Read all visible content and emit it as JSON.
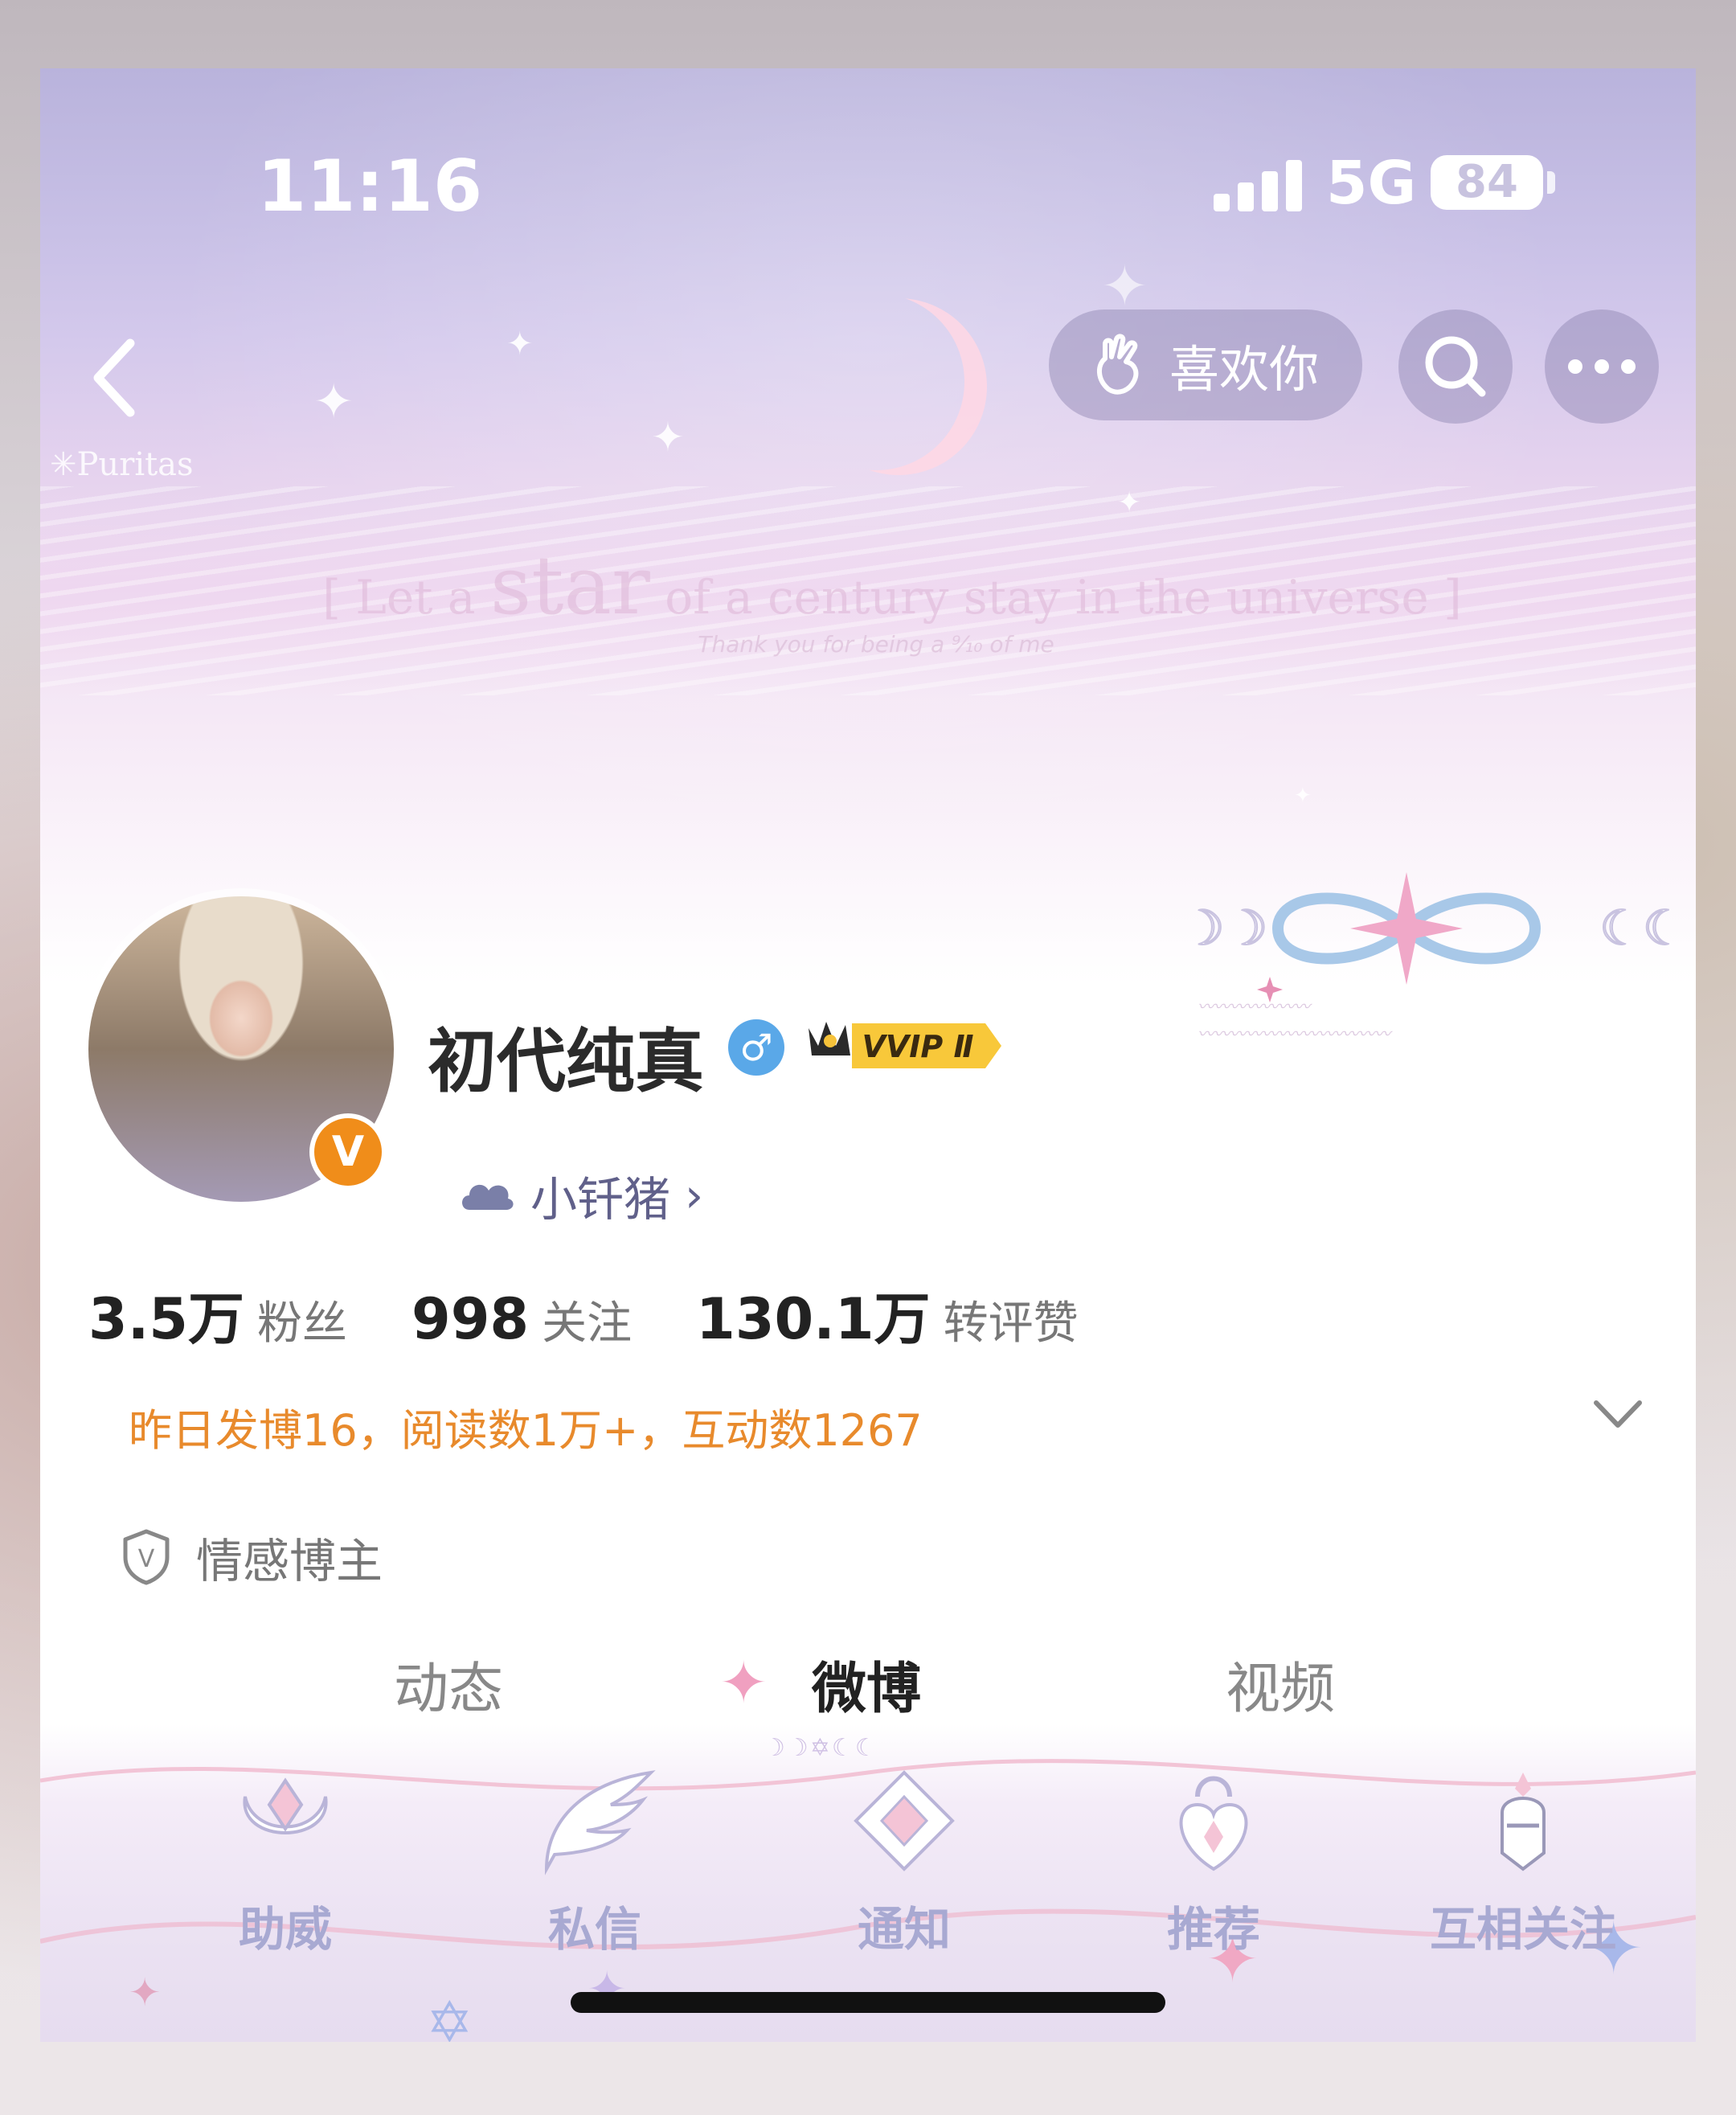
{
  "status_bar": {
    "time": "11:16",
    "network": "5G",
    "battery": "84"
  },
  "header": {
    "like_button_label": "喜欢你",
    "watermark": "✳Puritas",
    "quote_prefix": "[ Let a ",
    "quote_emphasis": "star",
    "quote_suffix": " of a century stay in the universe ]",
    "quote_sub": "Thank you for being a ⁹⁄₁₀ of me"
  },
  "profile": {
    "name": "初代纯真",
    "vip_label": "VVIP Ⅱ",
    "verified_letter": "V",
    "gender_symbol": "♂",
    "fan_group": "小钎猪",
    "chevron": "›",
    "stats": [
      {
        "value": "3.5万",
        "label": "粉丝"
      },
      {
        "value": "998",
        "label": "关注"
      },
      {
        "value": "130.1万",
        "label": "转评赞"
      }
    ],
    "daily_summary": "昨日发博16，阅读数1万+，互动数1267",
    "tag_icon_letter": "V",
    "tag": "情感博主"
  },
  "tabs": [
    {
      "label": "动态",
      "active": false
    },
    {
      "label": "微博",
      "active": true
    },
    {
      "label": "视频",
      "active": false
    }
  ],
  "actions": [
    {
      "label": "助威"
    },
    {
      "label": "私信"
    },
    {
      "label": "通知"
    },
    {
      "label": "推荐"
    },
    {
      "label": "互相关注"
    }
  ],
  "colors": {
    "accent_orange": "#e88a2c",
    "action_label": "#a8a9d2",
    "banner_lavender": "#c8c0e6"
  }
}
